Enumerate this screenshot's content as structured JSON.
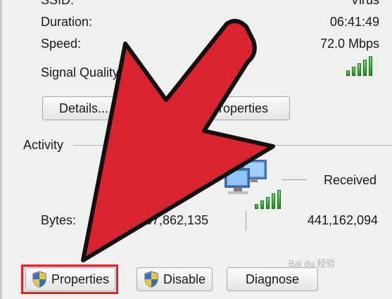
{
  "details": {
    "ssid_label": "SSID:",
    "ssid_value": "Virus",
    "duration_label": "Duration:",
    "duration_value": "06:41:49",
    "speed_label": "Speed:",
    "speed_value": "72.0 Mbps",
    "signal_label": "Signal Quality"
  },
  "connection_buttons": {
    "details_label": "Details...",
    "properties_label": "Properties"
  },
  "activity": {
    "section_title": "Activity",
    "received_label": "Received",
    "bytes_label": "Bytes:",
    "bytes_sent": "37,862,135",
    "bytes_received": "441,162,094"
  },
  "bottom_buttons": {
    "properties_label": "Properties",
    "disable_label": "Disable",
    "diagnose_label": "Diagnose"
  },
  "watermark": "Bai du 经验",
  "colors": {
    "arrow_fill": "#d9232e",
    "highlight_border": "#d8232a",
    "signal_green": "#2aa52a"
  },
  "icons": [
    "uac-shield-icon",
    "network-computers-icon",
    "wifi-signal-icon",
    "red-arrow-icon"
  ]
}
